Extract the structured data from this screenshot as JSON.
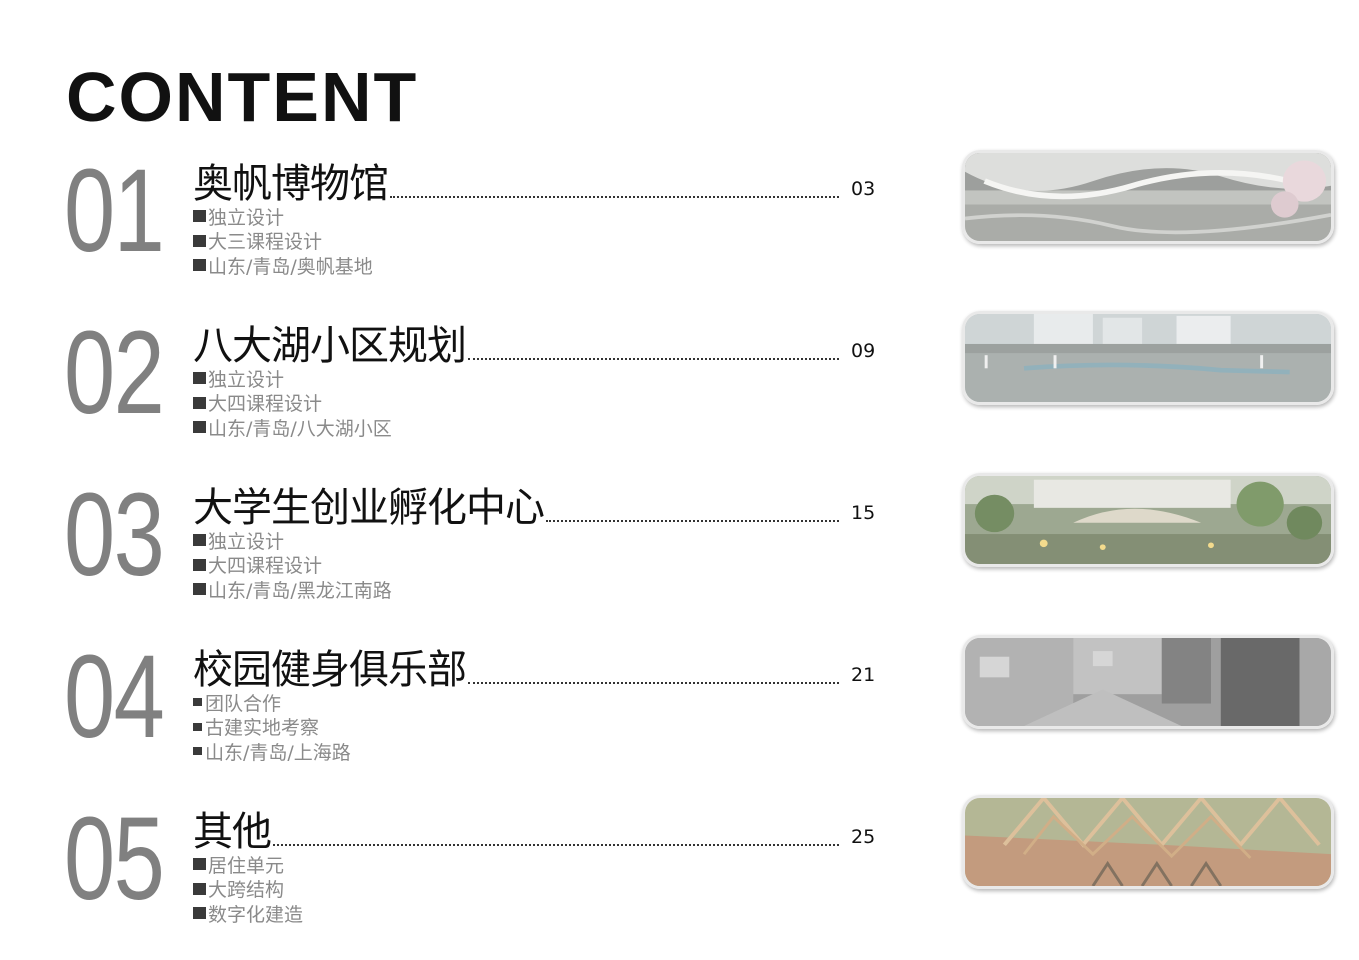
{
  "heading": "CONTENT",
  "entries": [
    {
      "num": "01",
      "title": "奥帆博物馆",
      "page": "03",
      "items": [
        "独立设计",
        "大三课程设计",
        "山东/青岛/奥帆基地"
      ]
    },
    {
      "num": "02",
      "title": "八大湖小区规划",
      "page": "09",
      "items": [
        "独立设计",
        "大四课程设计",
        "山东/青岛/八大湖小区"
      ]
    },
    {
      "num": "03",
      "title": "大学生创业孵化中心",
      "page": "15",
      "items": [
        "独立设计",
        "大四课程设计",
        "山东/青岛/黑龙江南路"
      ]
    },
    {
      "num": "04",
      "title": "校园健身俱乐部",
      "page": "21",
      "items": [
        "团队合作",
        "古建实地考察",
        "山东/青岛/上海路"
      ]
    },
    {
      "num": "05",
      "title": "其他",
      "page": "25",
      "items": [
        "居住单元",
        "大跨结构",
        "数字化建造"
      ]
    }
  ]
}
